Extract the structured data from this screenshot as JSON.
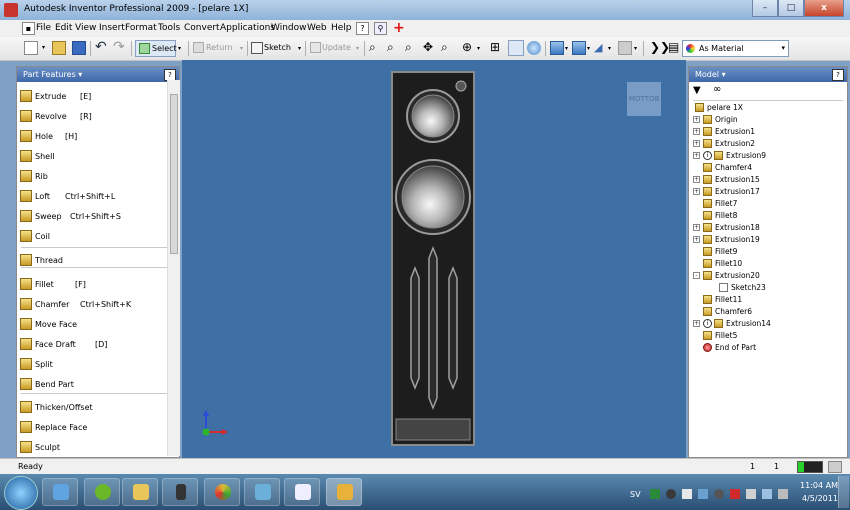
{
  "window": {
    "title": "Autodesk Inventor Professional 2009 - [pelare 1X]",
    "minimize": "–",
    "maximize": "□",
    "close": "x"
  },
  "menu": {
    "items": [
      "File",
      "Edit",
      "View",
      "Insert",
      "Format",
      "Tools",
      "Convert",
      "Applications",
      "Window",
      "Web",
      "Help"
    ]
  },
  "toolbar": {
    "select": "Select",
    "return": "Return",
    "sketch": "Sketch",
    "update": "Update",
    "material": "As Material"
  },
  "left_panel": {
    "title": "Part Features ▾",
    "help": "?",
    "features": [
      {
        "label": "Extrude",
        "shortcut": "[E]"
      },
      {
        "label": "Revolve",
        "shortcut": "[R]"
      },
      {
        "label": "Hole",
        "shortcut": "[H]"
      },
      {
        "label": "Shell",
        "shortcut": ""
      },
      {
        "label": "Rib",
        "shortcut": ""
      },
      {
        "label": "Loft",
        "shortcut": "Ctrl+Shift+L"
      },
      {
        "label": "Sweep",
        "shortcut": "Ctrl+Shift+S"
      },
      {
        "label": "Coil",
        "shortcut": ""
      },
      {
        "label": "Thread",
        "shortcut": ""
      },
      {
        "label": "Fillet",
        "shortcut": "[F]"
      },
      {
        "label": "Chamfer",
        "shortcut": "Ctrl+Shift+K"
      },
      {
        "label": "Move Face",
        "shortcut": ""
      },
      {
        "label": "Face Draft",
        "shortcut": "[D]"
      },
      {
        "label": "Split",
        "shortcut": ""
      },
      {
        "label": "Bend Part",
        "shortcut": ""
      },
      {
        "label": "Thicken/Offset",
        "shortcut": ""
      },
      {
        "label": "Replace Face",
        "shortcut": ""
      },
      {
        "label": "Sculpt",
        "shortcut": ""
      }
    ]
  },
  "viewport": {
    "viewcube_label": "BOTTOM",
    "background": "#3e6fa5"
  },
  "right_panel": {
    "title": "Model ▾",
    "help": "?",
    "root": "pelare 1X",
    "nodes": [
      {
        "label": "Origin",
        "level": 1,
        "expand": "+"
      },
      {
        "label": "Extrusion1",
        "level": 1,
        "expand": "+"
      },
      {
        "label": "Extrusion2",
        "level": 1,
        "expand": "+"
      },
      {
        "label": "Extrusion9",
        "level": 1,
        "expand": "+",
        "flag": "i"
      },
      {
        "label": "Chamfer4",
        "level": 1,
        "expand": ""
      },
      {
        "label": "Extrusion15",
        "level": 1,
        "expand": "+"
      },
      {
        "label": "Extrusion17",
        "level": 1,
        "expand": "+"
      },
      {
        "label": "Fillet7",
        "level": 1,
        "expand": ""
      },
      {
        "label": "Fillet8",
        "level": 1,
        "expand": ""
      },
      {
        "label": "Extrusion18",
        "level": 1,
        "expand": "+"
      },
      {
        "label": "Extrusion19",
        "level": 1,
        "expand": "+"
      },
      {
        "label": "Fillet9",
        "level": 1,
        "expand": ""
      },
      {
        "label": "Fillet10",
        "level": 1,
        "expand": ""
      },
      {
        "label": "Extrusion20",
        "level": 1,
        "expand": "-"
      },
      {
        "label": "Sketch23",
        "level": 2,
        "expand": ""
      },
      {
        "label": "Fillet11",
        "level": 1,
        "expand": ""
      },
      {
        "label": "Chamfer6",
        "level": 1,
        "expand": ""
      },
      {
        "label": "Extrusion14",
        "level": 1,
        "expand": "+",
        "flag": "i"
      },
      {
        "label": "Fillet5",
        "level": 1,
        "expand": ""
      },
      {
        "label": "End of Part",
        "level": 1,
        "expand": "",
        "end": true
      }
    ]
  },
  "status": {
    "text": "Ready",
    "count1": "1",
    "count2": "1"
  },
  "taskbar": {
    "lang": "SV",
    "time": "11:04 AM",
    "date": "4/5/2011"
  },
  "colors": {
    "viewport": "#3e6fa5",
    "panel_header": "#4a74b2",
    "feature_icon": "#e0b84a"
  }
}
